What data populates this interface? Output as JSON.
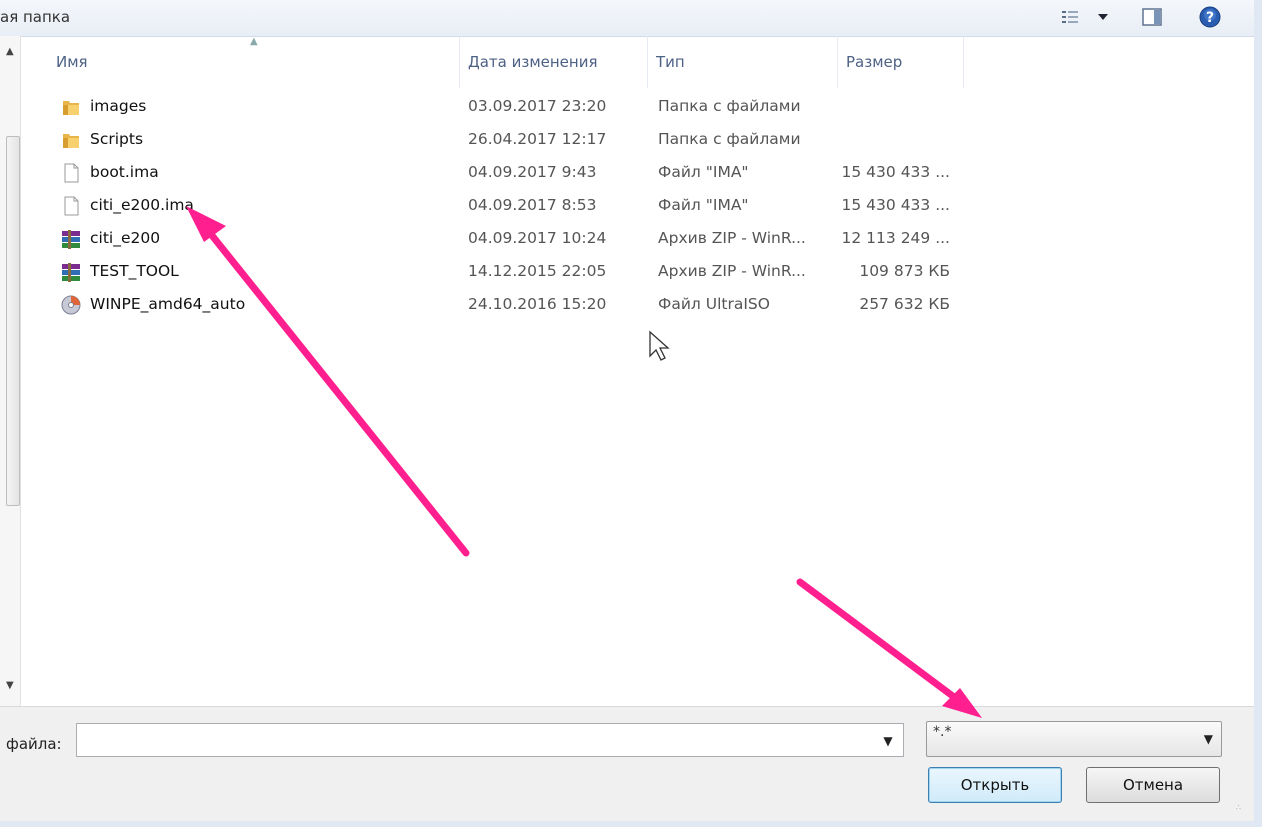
{
  "window": {
    "breadcrumb": "ая папка",
    "toolbar_icons": [
      "view-options-icon",
      "chevron-down-icon",
      "preview-pane-icon",
      "help-icon"
    ]
  },
  "columns": {
    "name": "Имя",
    "date": "Дата изменения",
    "type": "Тип",
    "size": "Размер"
  },
  "files": [
    {
      "name": "images",
      "date": "03.09.2017 23:20",
      "type": "Папка с файлами",
      "size": "",
      "icon": "folder-icon"
    },
    {
      "name": "Scripts",
      "date": "26.04.2017 12:17",
      "type": "Папка с файлами",
      "size": "",
      "icon": "folder-icon"
    },
    {
      "name": "boot.ima",
      "date": "04.09.2017 9:43",
      "type": "Файл \"IMA\"",
      "size": "15 430 433 ...",
      "icon": "file-icon"
    },
    {
      "name": "citi_e200.ima",
      "date": "04.09.2017 8:53",
      "type": "Файл \"IMA\"",
      "size": "15 430 433 ...",
      "icon": "file-icon"
    },
    {
      "name": "citi_e200",
      "date": "04.09.2017 10:24",
      "type": "Архив ZIP - WinR...",
      "size": "12 113 249 ...",
      "icon": "winrar-archive-icon"
    },
    {
      "name": "TEST_TOOL",
      "date": "14.12.2015 22:05",
      "type": "Архив ZIP - WinR...",
      "size": "109 873 КБ",
      "icon": "winrar-archive-icon"
    },
    {
      "name": "WINPE_amd64_auto",
      "date": "24.10.2016 15:20",
      "type": "Файл UltraISO",
      "size": "257 632 КБ",
      "icon": "disc-image-icon"
    }
  ],
  "footer": {
    "filename_label": "файла:",
    "filename_value": "",
    "filter_value": "*.*",
    "open_button": "Открыть",
    "cancel_button": "Отмена"
  },
  "annotation_color": "#ff1f8e"
}
